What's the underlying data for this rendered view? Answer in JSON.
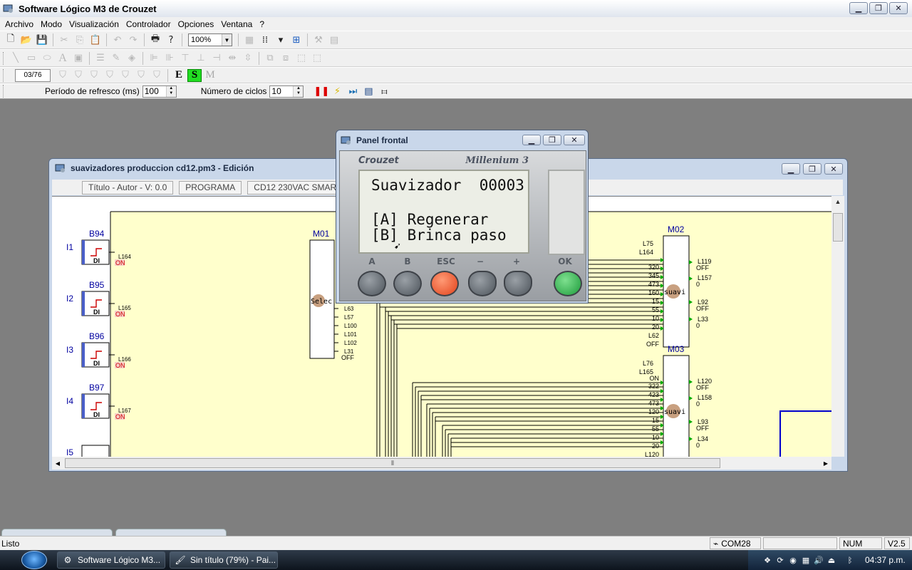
{
  "window": {
    "title": "Software Lógico M3 de Crouzet"
  },
  "menu": [
    "Archivo",
    "Modo",
    "Visualización",
    "Controlador",
    "Opciones",
    "Ventana",
    "?"
  ],
  "toolbar": {
    "zoom": "100%",
    "page_counter": "03/76",
    "mode_letters": [
      "E",
      "S",
      "M"
    ],
    "refresh_label": "Período de refresco (ms)",
    "refresh_value": "100",
    "cycles_label": "Número de ciclos",
    "cycles_value": "10"
  },
  "editor": {
    "title": "suavizadores produccion cd12.pm3 - Edición",
    "info_fields": [
      "Título - Autor - V: 0.0",
      "PROGRAMA",
      "CD12 230VAC SMART"
    ]
  },
  "diagram": {
    "inputs": [
      {
        "pin": "I1",
        "block": "B94",
        "type": "DI",
        "link": "L164",
        "state": "ON"
      },
      {
        "pin": "I2",
        "block": "B95",
        "type": "DI",
        "link": "L165",
        "state": "ON"
      },
      {
        "pin": "I3",
        "block": "B96",
        "type": "DI",
        "link": "L166",
        "state": "ON"
      },
      {
        "pin": "I4",
        "block": "B97",
        "type": "DI",
        "link": "L167",
        "state": "ON"
      },
      {
        "pin": "I5",
        "block": "",
        "type": "",
        "link": "",
        "state": ""
      }
    ],
    "macro_m01": {
      "name": "M01",
      "label": "Selec",
      "outputs": [
        "L63",
        "L57",
        "L100",
        "L101",
        "L102",
        "L31"
      ],
      "last_state": "OFF"
    },
    "macro_m02": {
      "name": "M02",
      "label": "suavi",
      "inputs": [
        "L75",
        "L164",
        "320",
        "345",
        "473",
        "160",
        "15",
        "55",
        "10",
        "20",
        "L62"
      ],
      "last_state": "OFF",
      "outputs": [
        {
          "link": "L119",
          "state": "OFF"
        },
        {
          "link": "L157",
          "state": "0"
        },
        {
          "link": "L92",
          "state": "OFF"
        },
        {
          "link": "L33",
          "state": "0"
        }
      ]
    },
    "macro_m03": {
      "name": "M03",
      "label": "suavi",
      "inputs": [
        "L76",
        "L165",
        "322",
        "423",
        "473",
        "120",
        "15",
        "55",
        "10",
        "20",
        "L120"
      ],
      "first_state": "ON",
      "outputs": [
        {
          "link": "L120",
          "state": "OFF"
        },
        {
          "link": "L158",
          "state": "0"
        },
        {
          "link": "L93",
          "state": "OFF"
        },
        {
          "link": "L34",
          "state": "0"
        }
      ]
    }
  },
  "front_panel": {
    "title": "Panel frontal",
    "brand": "Crouzet",
    "model": "Millenium 3",
    "lcd_lines": [
      "Suavizador  00003",
      "",
      "[A] Regenerar",
      "[B] Brinca paso"
    ],
    "keys": [
      "A",
      "B",
      "ESC",
      "−",
      "+",
      "OK"
    ]
  },
  "status_bar": {
    "text": "Listo",
    "port": "COM28",
    "num": "NUM",
    "version": "V2.5"
  },
  "taskbar": {
    "tasks": [
      "Software Lógico M3...",
      "Sin título (79%) - Pai..."
    ],
    "clock": "04:37 p.m."
  },
  "colors": {
    "canvas_bg": "#ffffcc",
    "wire": "#000000",
    "link_on": "#cc0000",
    "pin_green": "#00aa00",
    "esc_key": "#e2421b",
    "ok_key": "#1d9b3b",
    "lcd_bg": "#eceee6"
  }
}
